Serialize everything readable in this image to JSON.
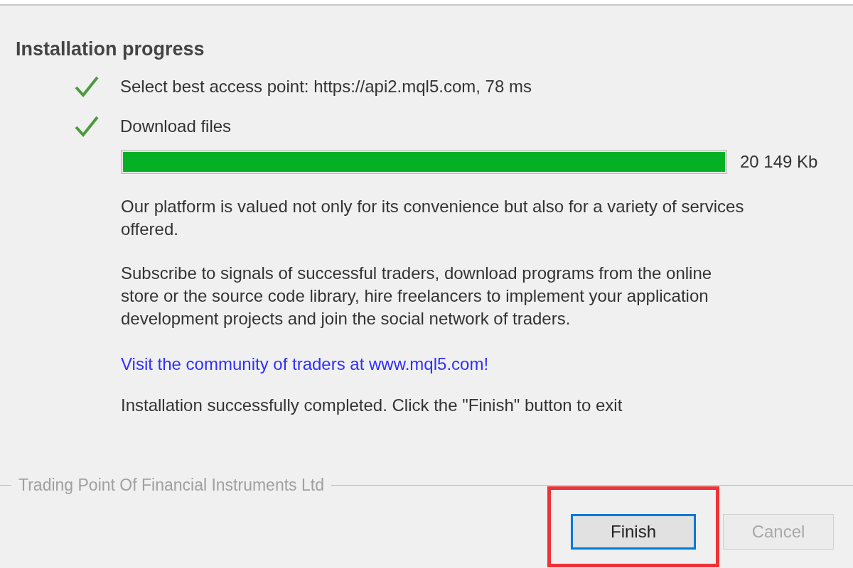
{
  "title": "Installation progress",
  "steps": [
    {
      "label": "Select best access point: https://api2.mql5.com, 78 ms",
      "done": true
    },
    {
      "label": "Download files",
      "done": true
    }
  ],
  "progress": {
    "level": 1,
    "reading": "20 149 Kb"
  },
  "paragraphs": [
    "Our platform is valued not only for its convenience but also for a variety of services offered.",
    "Subscribe to signals of successful traders, download programs from the online store or the source code library, hire freelancers to implement your application development projects and join the social network of traders."
  ],
  "link": "Visit the community of traders at www.mql5.com!",
  "status": "Installation successfully completed. Click the \"Finish\" button to exit",
  "footer": "Trading Point Of Financial Instruments Ltd",
  "buttons": [
    {
      "label": "Finish",
      "disabled": false,
      "focused": true,
      "highlighted": true
    },
    {
      "label": "Cancel",
      "disabled": true,
      "focused": false,
      "highlighted": false
    }
  ]
}
